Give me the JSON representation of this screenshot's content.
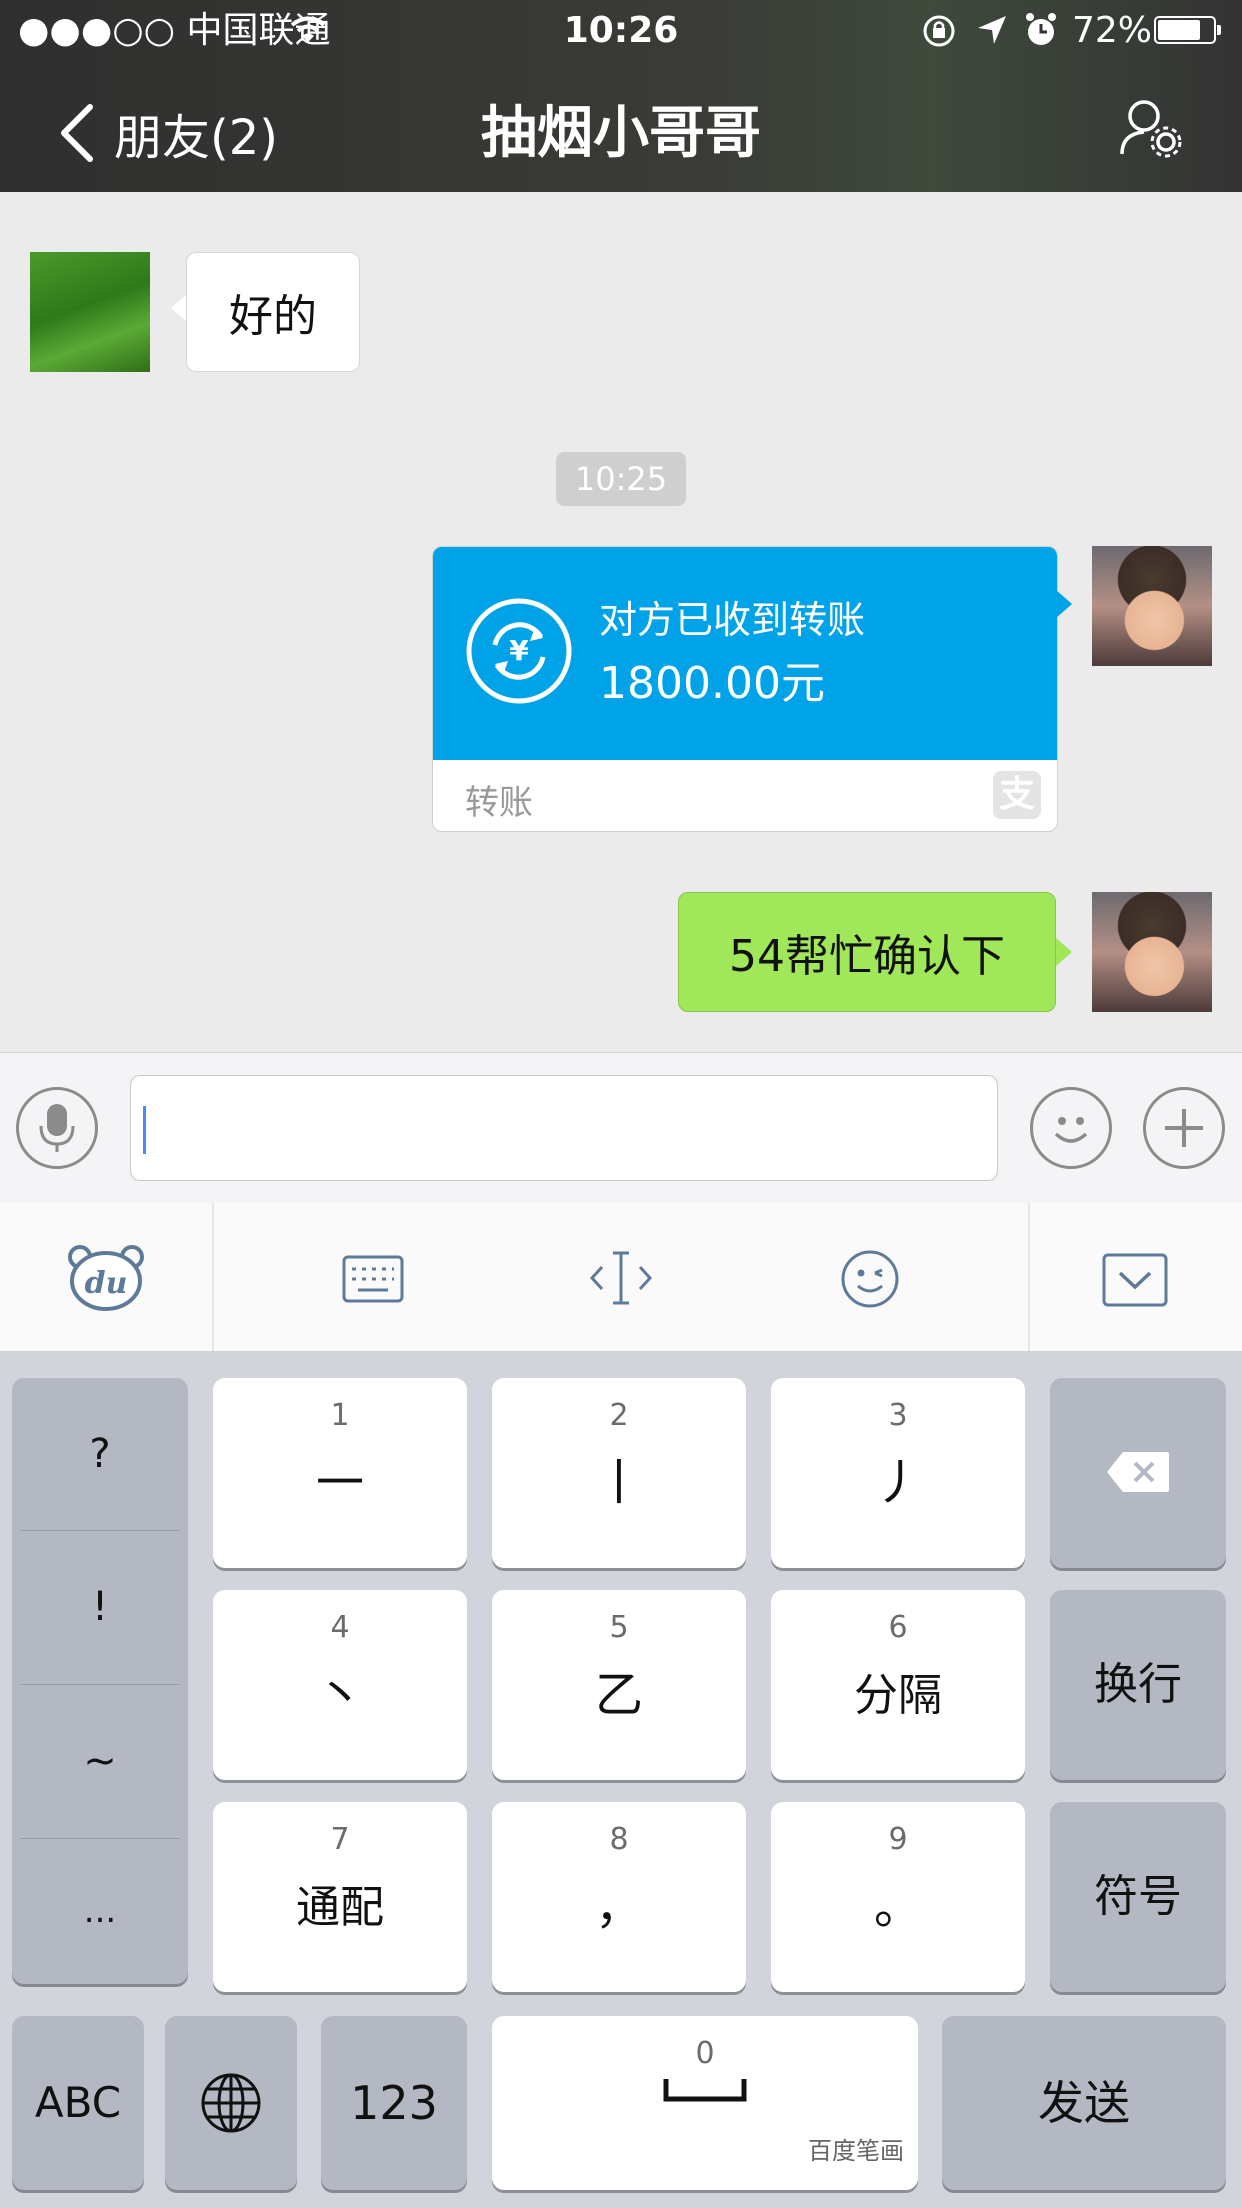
{
  "status_bar": {
    "carrier": "●●●○○ 中国联通",
    "time": "10:26",
    "battery": "72%"
  },
  "nav": {
    "back_label": "朋友(2)",
    "title": "抽烟小哥哥"
  },
  "messages": {
    "incoming_text": "好的",
    "timestamp": "10:25",
    "transfer": {
      "status": "对方已收到转账",
      "amount": "1800.00元",
      "footer_label": "转账",
      "brand_glyph": "支"
    },
    "outgoing_text": "54帮忙确认下"
  },
  "input_bar": {
    "text_value": ""
  },
  "keyboard": {
    "punct": [
      "?",
      "!",
      "~",
      "..."
    ],
    "stroke_keys": [
      {
        "num": "1",
        "label": "一"
      },
      {
        "num": "2",
        "label": "丨"
      },
      {
        "num": "3",
        "label": "丿"
      },
      {
        "num": "4",
        "label": "丶"
      },
      {
        "num": "5",
        "label": "乙"
      },
      {
        "num": "6",
        "label": "分隔"
      },
      {
        "num": "7",
        "label": "通配"
      },
      {
        "num": "8",
        "label": "，"
      },
      {
        "num": "9",
        "label": "。"
      }
    ],
    "enter_label": "换行",
    "symbol_label": "符号",
    "abc_label": "ABC",
    "num_label": "123",
    "space_num": "0",
    "space_hint": "百度笔画",
    "send_label": "发送"
  },
  "colors": {
    "transfer_blue": "#00a3e8",
    "outgoing_green": "#a0e75a"
  }
}
